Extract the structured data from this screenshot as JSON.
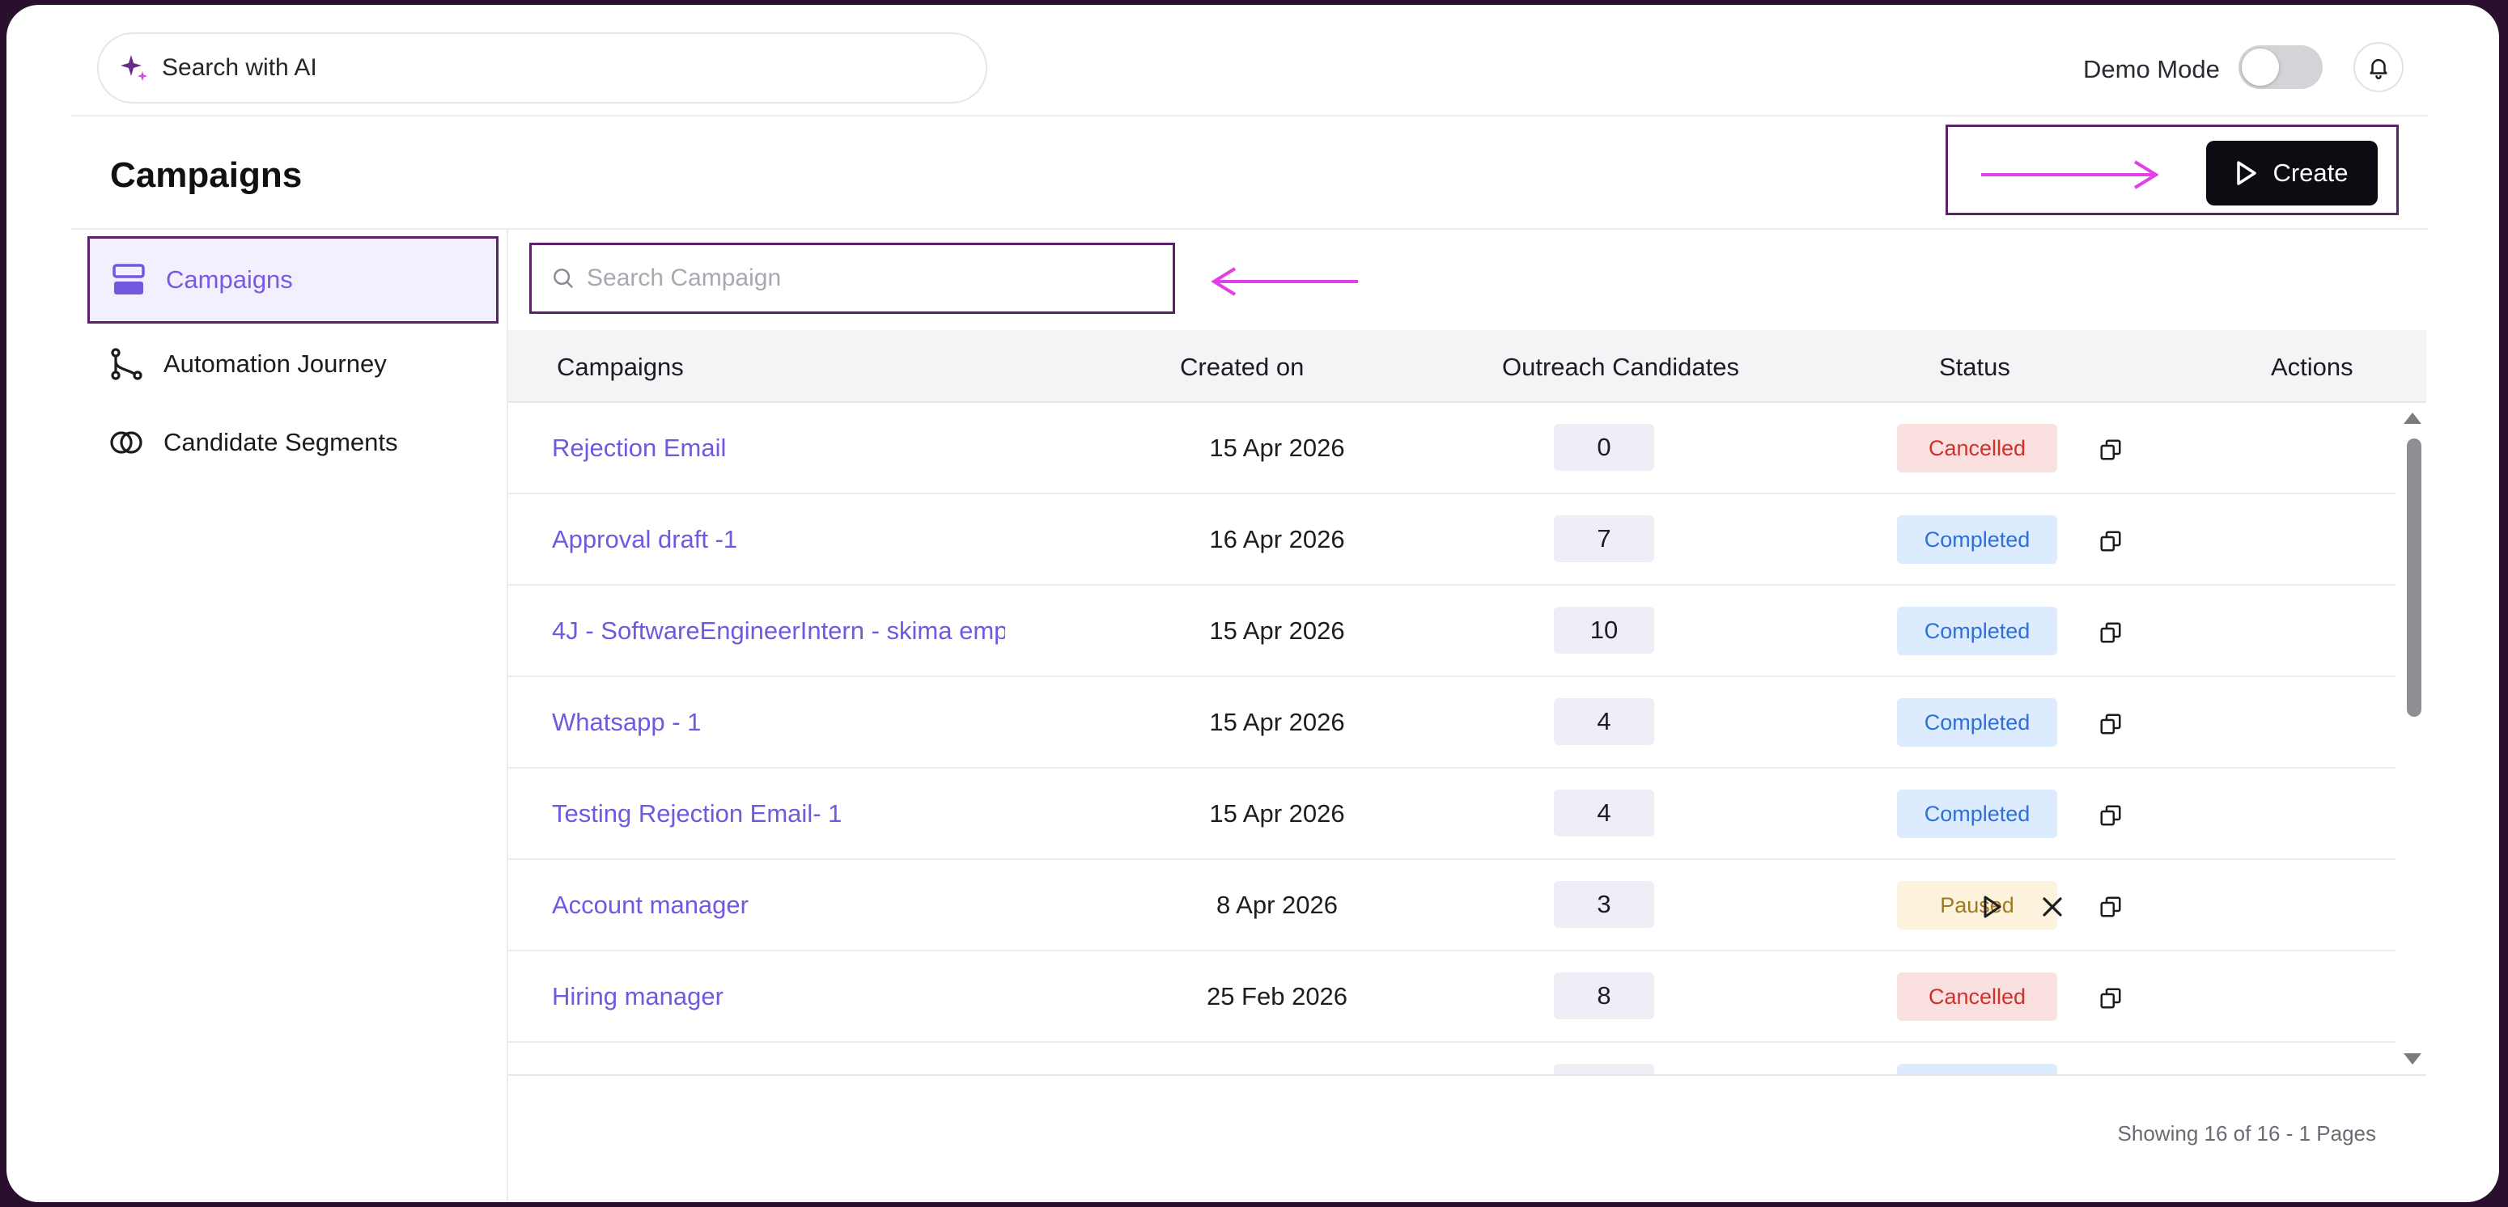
{
  "topbar": {
    "ai_search_placeholder": "Search with AI",
    "demo_mode_label": "Demo Mode",
    "demo_mode_enabled": false
  },
  "page": {
    "title": "Campaigns",
    "create_label": "Create"
  },
  "sidebar": {
    "items": [
      {
        "label": "Campaigns",
        "icon": "campaigns-icon",
        "active": true
      },
      {
        "label": "Automation Journey",
        "icon": "journey-icon",
        "active": false
      },
      {
        "label": "Candidate Segments",
        "icon": "segments-icon",
        "active": false
      }
    ]
  },
  "search": {
    "placeholder": "Search Campaign"
  },
  "table": {
    "headers": [
      "Campaigns",
      "Created on",
      "Outreach Candidates",
      "Status",
      "Actions"
    ],
    "rows": [
      {
        "name": "Rejection Email",
        "created": "15 Apr 2026",
        "candidates": "0",
        "status": "Cancelled"
      },
      {
        "name": "Approval draft -1",
        "created": "16 Apr 2026",
        "candidates": "7",
        "status": "Completed"
      },
      {
        "name": "4J - SoftwareEngineerIntern - skima emp",
        "created": "15 Apr 2026",
        "candidates": "10",
        "status": "Completed"
      },
      {
        "name": "Whatsapp - 1",
        "created": "15 Apr 2026",
        "candidates": "4",
        "status": "Completed"
      },
      {
        "name": "Testing Rejection Email- 1",
        "created": "15 Apr 2026",
        "candidates": "4",
        "status": "Completed"
      },
      {
        "name": "Account manager",
        "created": "8 Apr 2026",
        "candidates": "3",
        "status": "Paused"
      },
      {
        "name": "Hiring manager",
        "created": "25 Feb 2026",
        "candidates": "8",
        "status": "Cancelled"
      }
    ],
    "pagination": "Showing 16 of 16 - 1 Pages"
  },
  "colors": {
    "accent": "#7357e0",
    "highlight_border": "#5b2169",
    "annotation_arrow": "#e040e6",
    "cancelled_bg": "#fbe0e0",
    "cancelled_fg": "#d0312d",
    "completed_bg": "#dcebfd",
    "completed_fg": "#2f6fd8",
    "paused_bg": "#fdf3dc",
    "paused_fg": "#a07a22"
  }
}
